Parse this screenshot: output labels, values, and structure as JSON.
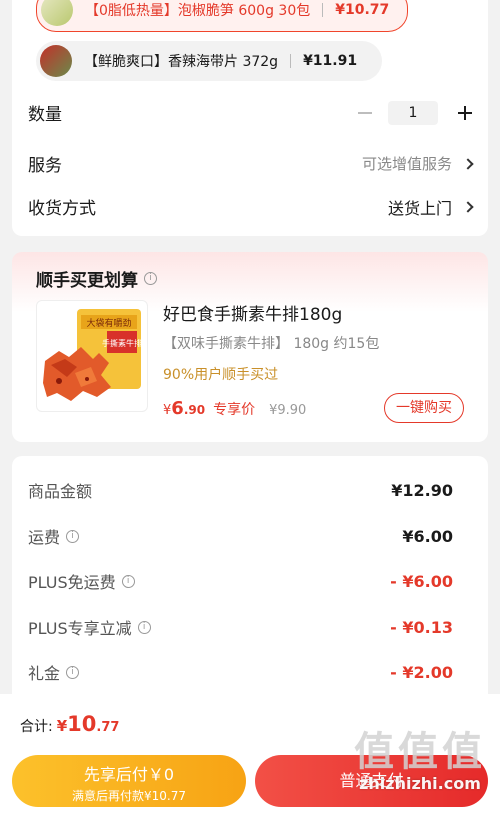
{
  "variants": [
    {
      "tag": "【0脂低热量】",
      "name": "泡椒脆笋 600g 30包",
      "price": "¥10.77",
      "selected": true
    },
    {
      "tag": "【鲜脆爽口】",
      "name": "香辣海带片 372g",
      "price": "¥11.91",
      "selected": false
    }
  ],
  "quantity": {
    "label": "数量",
    "value": "1"
  },
  "service": {
    "label": "服务",
    "value": "可选增值服务"
  },
  "delivery": {
    "label": "收货方式",
    "value": "送货上门"
  },
  "recommend": {
    "title": "顺手买更划算",
    "product_name": "好巴食手撕素牛排180g",
    "spec": "【双味手撕素牛排】 180g 约15包",
    "percent_text": "90%用户顺手买过",
    "price_currency": "¥",
    "price_int": "6",
    "price_dec": ".90",
    "price_tag": "专享价",
    "original_price": "¥9.90",
    "buy_label": "一键购买",
    "image_label_1": "大袋有嚼劲",
    "image_label_2": "手撕素牛排"
  },
  "fees": [
    {
      "label": "商品金额",
      "amount": "¥12.90",
      "info": false,
      "red": false
    },
    {
      "label": "运费",
      "amount": "¥6.00",
      "info": true,
      "red": false
    },
    {
      "label": "PLUS免运费",
      "amount": "- ¥6.00",
      "info": true,
      "red": true
    },
    {
      "label": "PLUS专享立减",
      "amount": "- ¥0.13",
      "info": true,
      "red": true
    },
    {
      "label": "礼金",
      "amount": "- ¥2.00",
      "info": true,
      "red": true
    }
  ],
  "total": {
    "label": "合计:",
    "currency": "¥",
    "int": "10",
    "dec": ".77"
  },
  "pay_later": {
    "line1": "先享后付￥0",
    "line2": "满意后再付款¥10.77"
  },
  "pay_normal": {
    "label": "普通支付"
  },
  "watermark": {
    "logo": "值值值",
    "site": "zhizhizhi.com"
  },
  "colors": {
    "accent_red": "#e4392a",
    "gold": "#f7a314"
  },
  "icons": {
    "info": "info-icon",
    "chevron": "chevron-right-icon",
    "plus": "plus-icon",
    "minus": "minus-icon"
  }
}
